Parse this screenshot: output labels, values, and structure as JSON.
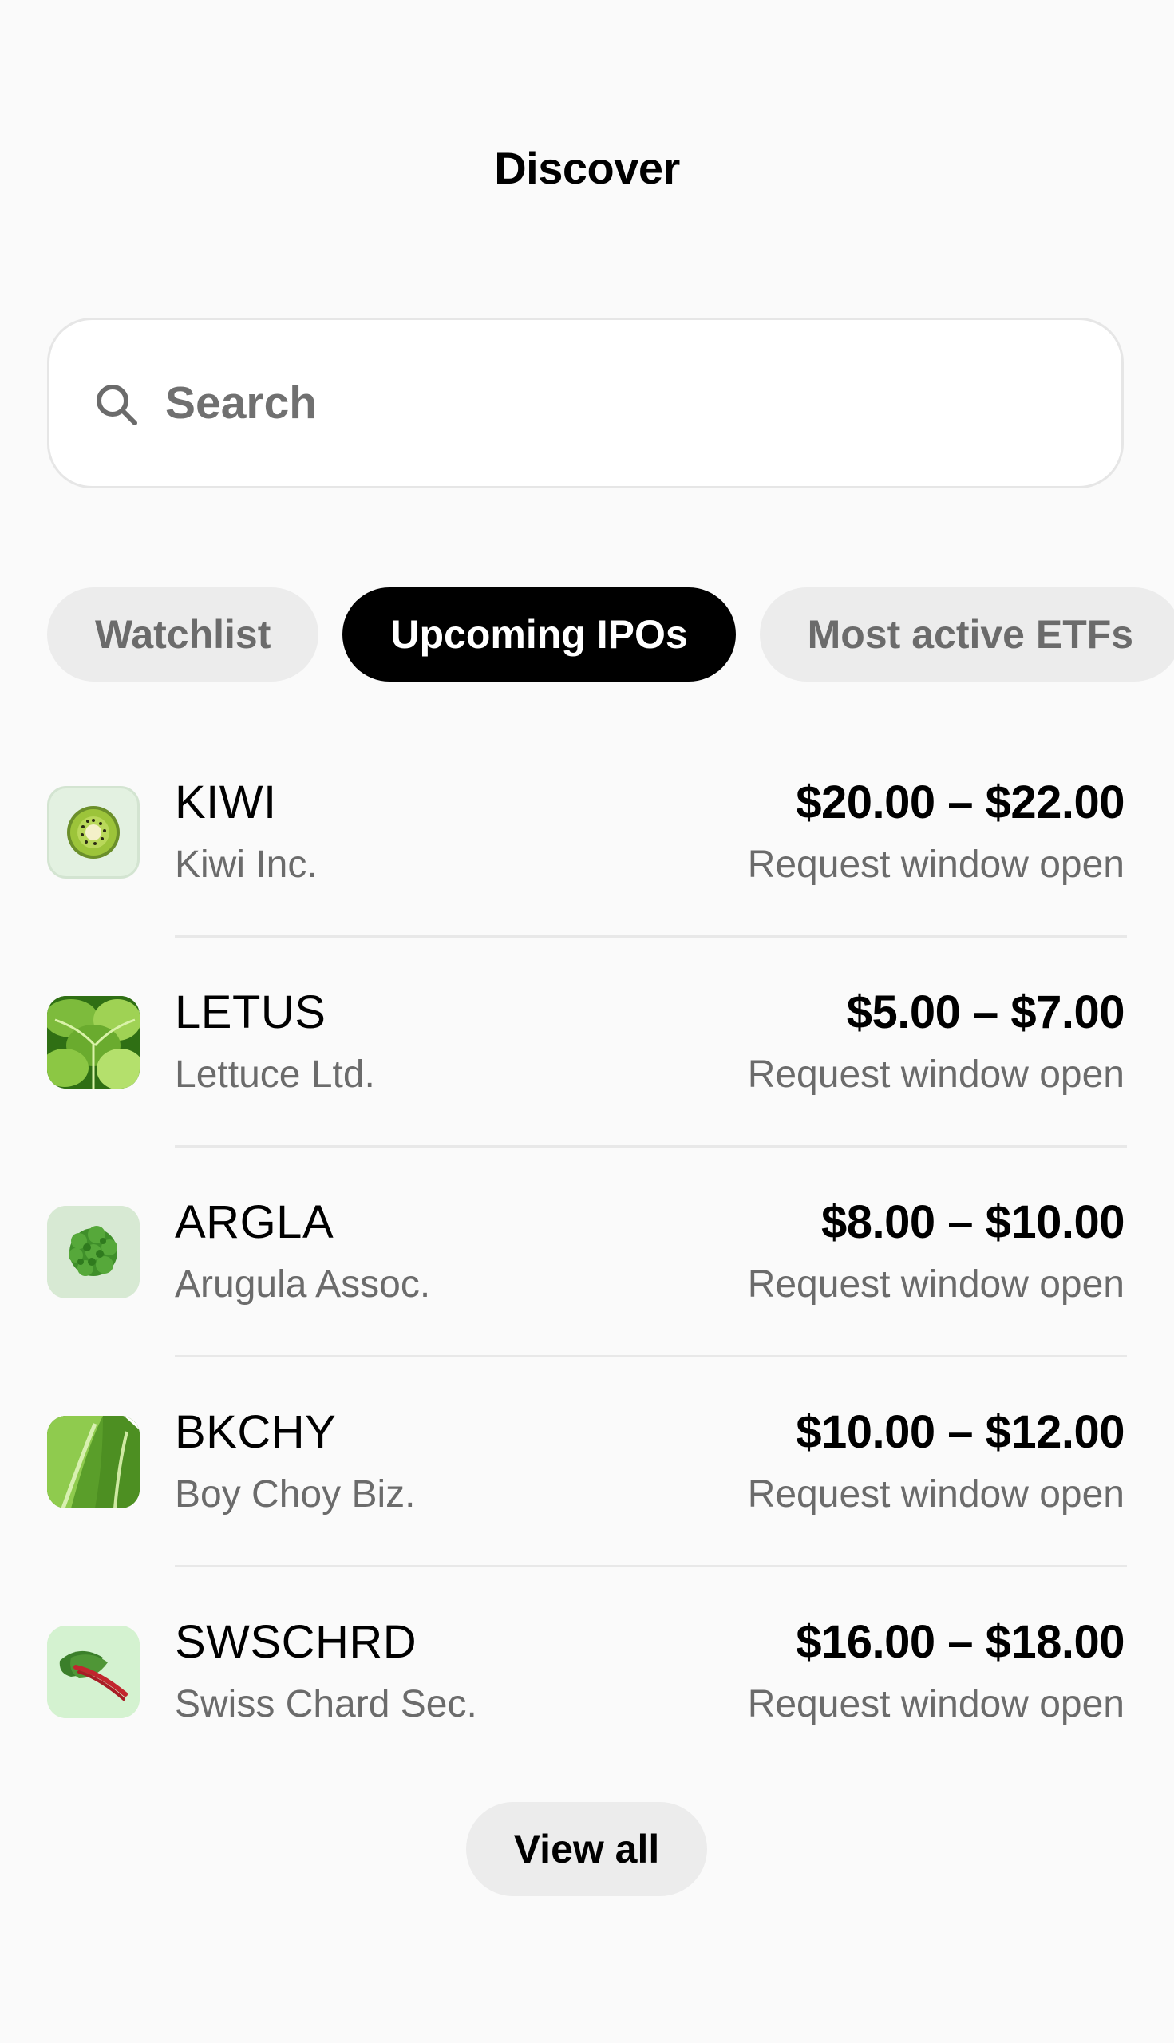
{
  "header": {
    "title": "Discover"
  },
  "search": {
    "placeholder": "Search",
    "icon": "search-icon"
  },
  "tabs": [
    {
      "label": "Watchlist",
      "active": false
    },
    {
      "label": "Upcoming IPOs",
      "active": true
    },
    {
      "label": "Most active ETFs",
      "active": false
    }
  ],
  "ipos": [
    {
      "ticker": "KIWI",
      "company": "Kiwi Inc.",
      "price_range": "$20.00 – $22.00",
      "status": "Request window open",
      "icon": "kiwi-icon"
    },
    {
      "ticker": "LETUS",
      "company": "Lettuce Ltd.",
      "price_range": "$5.00 – $7.00",
      "status": "Request window open",
      "icon": "lettuce-icon"
    },
    {
      "ticker": "ARGLA",
      "company": "Arugula Assoc.",
      "price_range": "$8.00 – $10.00",
      "status": "Request window open",
      "icon": "arugula-icon"
    },
    {
      "ticker": "BKCHY",
      "company": "Boy Choy Biz.",
      "price_range": "$10.00 – $12.00",
      "status": "Request window open",
      "icon": "bok-choy-icon"
    },
    {
      "ticker": "SWSCHRD",
      "company": "Swiss Chard Sec.",
      "price_range": "$16.00 – $18.00",
      "status": "Request window open",
      "icon": "swiss-chard-icon"
    }
  ],
  "footer": {
    "view_all_label": "View all"
  },
  "colors": {
    "background": "#fafafa",
    "active_tab": "#000000",
    "inactive_tab": "#ececec",
    "muted_text": "#6b6b6b"
  }
}
